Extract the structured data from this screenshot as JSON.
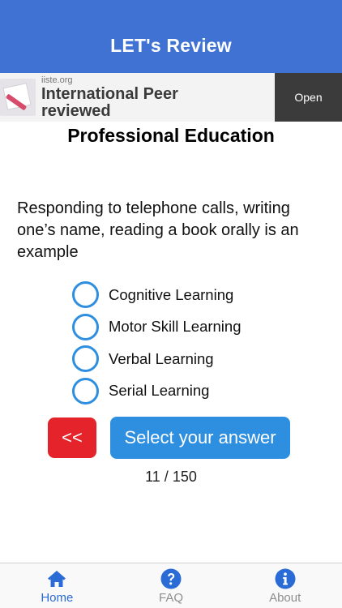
{
  "nav": {
    "title": "LET's Review"
  },
  "ad": {
    "domain": "iiste.org",
    "headline_line1": "International Peer",
    "headline_line2": "reviewed",
    "open_label": "Open"
  },
  "quiz": {
    "section_title": "Professional Education",
    "question": "Responding to telephone calls, writing one’s name, reading a book orally is an example",
    "options": [
      {
        "label": "Cognitive Learning"
      },
      {
        "label": "Motor Skill Learning"
      },
      {
        "label": "Verbal Learning"
      },
      {
        "label": "Serial Learning"
      }
    ],
    "back_label": "<<",
    "answer_label": "Select your answer",
    "progress": "11 / 150"
  },
  "tabs": [
    {
      "label": "Home",
      "icon": "home-icon",
      "active": true
    },
    {
      "label": "FAQ",
      "icon": "question-circle-icon",
      "active": false
    },
    {
      "label": "About",
      "icon": "info-circle-icon",
      "active": false
    }
  ],
  "colors": {
    "nav_bg": "#3f72d3",
    "accent_blue": "#2e8fe0",
    "back_red": "#e5232b",
    "tab_active": "#2b6bd6",
    "tab_inactive": "#8e8e8e"
  }
}
